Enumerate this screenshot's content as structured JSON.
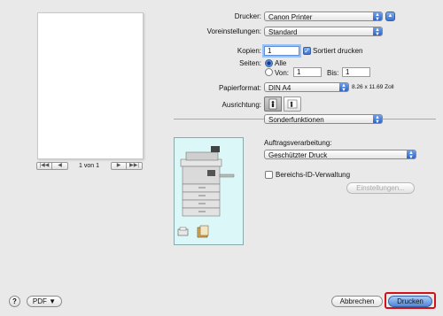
{
  "preview": {
    "first_icon": "first-page-icon",
    "prev_icon": "previous-page-icon",
    "page_indicator": "1 von 1",
    "next_icon": "next-page-icon",
    "last_icon": "last-page-icon"
  },
  "printer": {
    "label": "Drucker:",
    "value": "Canon Printer"
  },
  "presets": {
    "label": "Voreinstellungen:",
    "value": "Standard"
  },
  "copies": {
    "label": "Kopien:",
    "value": "1",
    "collate_label": "Sortiert drucken",
    "collate_checked": true
  },
  "pages": {
    "label": "Seiten:",
    "all_label": "Alle",
    "from_label": "Von:",
    "from_value": "1",
    "to_label": "Bis:",
    "to_value": "1"
  },
  "paper": {
    "label": "Papierformat:",
    "value": "DIN A4",
    "dimensions": "8.26 x 11.69 Zoll"
  },
  "orientation": {
    "label": "Ausrichtung:"
  },
  "panel": {
    "value": "Sonderfunktionen"
  },
  "job": {
    "label": "Auftragsverarbeitung:",
    "value": "Geschützter Druck",
    "dept_id_label": "Bereichs-ID-Verwaltung",
    "dept_id_checked": false,
    "settings_button": "Einstellungen..."
  },
  "footer": {
    "help": "?",
    "pdf": "PDF ▼",
    "cancel": "Abbrechen",
    "print": "Drucken"
  },
  "colors": {
    "accent": "#3b72cf",
    "highlight": "#d0101a",
    "printer_bg": "#dcf7f7"
  }
}
